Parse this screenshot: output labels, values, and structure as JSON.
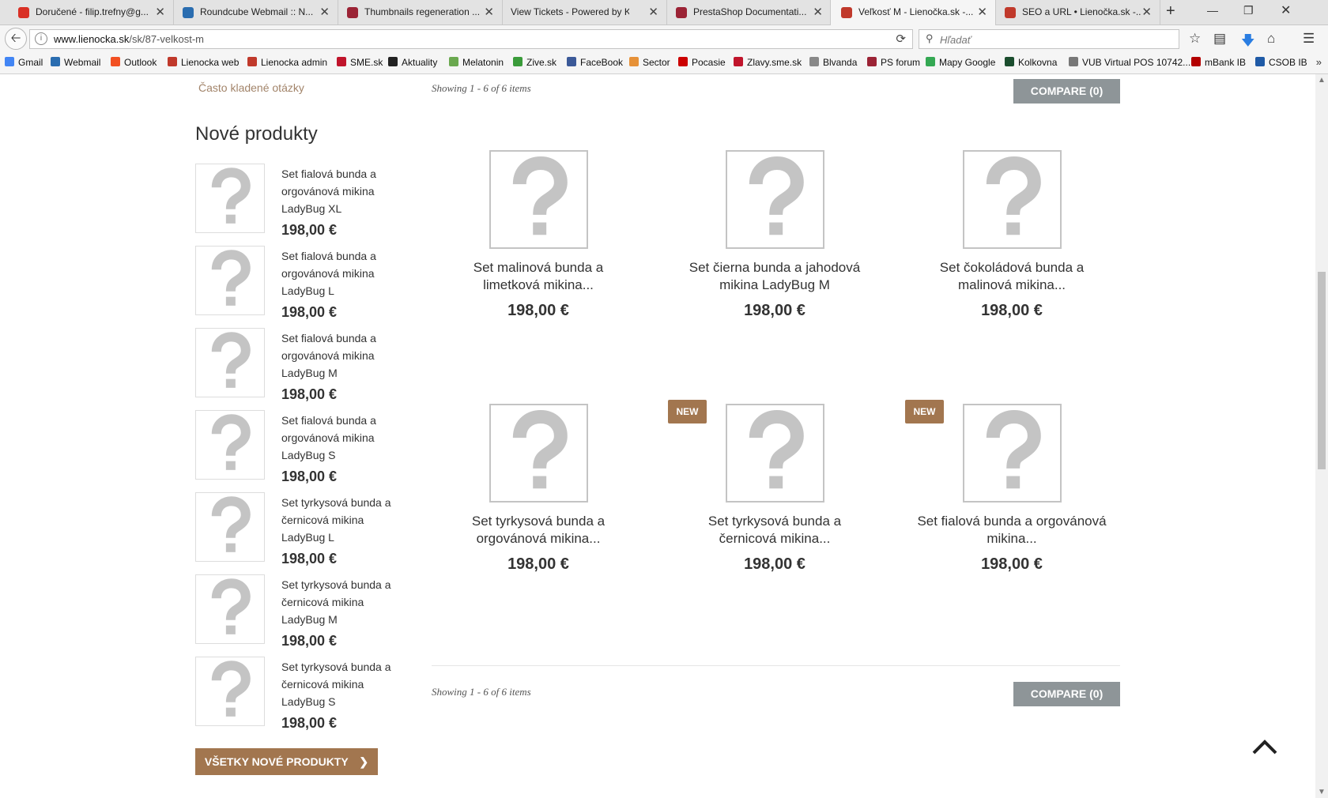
{
  "browser": {
    "tabs": [
      {
        "title": "Doručené - filip.trefny@g...",
        "icon": "gmail-icon",
        "color": "#d93025",
        "active": false
      },
      {
        "title": "Roundcube Webmail :: N...",
        "icon": "roundcube-icon",
        "color": "#2a6db0",
        "active": false
      },
      {
        "title": "Thumbnails regeneration ...",
        "icon": "prestashop-icon",
        "color": "#9b2335",
        "active": false
      },
      {
        "title": "View Tickets - Powered by Ka...",
        "icon": "",
        "color": "",
        "active": false
      },
      {
        "title": "PrestaShop Documentati...",
        "icon": "prestashop-icon",
        "color": "#9b2335",
        "active": false
      },
      {
        "title": "Veľkosť M - Lienočka.sk -...",
        "icon": "lienocka-icon",
        "color": "#c0392b",
        "active": true
      },
      {
        "title": "SEO a URL • Lienočka.sk -...",
        "icon": "lienocka-icon",
        "color": "#c0392b",
        "active": false
      }
    ],
    "url_host": "www.lienocka.sk",
    "url_path": "/sk/87-velkost-m",
    "search_placeholder": "Hľadať",
    "bookmarks": [
      {
        "label": "Gmail",
        "color": "#4285f4"
      },
      {
        "label": "Webmail",
        "color": "#2a6db0"
      },
      {
        "label": "Outlook",
        "color": "#f25022"
      },
      {
        "label": "Lienocka web",
        "color": "#c0392b"
      },
      {
        "label": "Lienocka admin",
        "color": "#c0392b"
      },
      {
        "label": "SME.sk",
        "color": "#c0142b"
      },
      {
        "label": "Aktuality",
        "color": "#222222"
      },
      {
        "label": "Melatonin",
        "color": "#6aa84f"
      },
      {
        "label": "Zive.sk",
        "color": "#3a9b3a"
      },
      {
        "label": "FaceBook",
        "color": "#3b5998"
      },
      {
        "label": "Sector",
        "color": "#e69138"
      },
      {
        "label": "Pocasie",
        "color": "#cc0000"
      },
      {
        "label": "Zlavy.sme.sk",
        "color": "#c0142b"
      },
      {
        "label": "Blvanda",
        "color": "#888888"
      },
      {
        "label": "PS forum",
        "color": "#9b2335"
      },
      {
        "label": "Mapy Google",
        "color": "#34a853"
      },
      {
        "label": "Kolkovna",
        "color": "#1b4d2e"
      },
      {
        "label": "VUB Virtual POS 10742...",
        "color": "#777777"
      },
      {
        "label": "mBank IB",
        "color": "#b30000"
      },
      {
        "label": "CSOB IB",
        "color": "#1f5aa6"
      }
    ]
  },
  "page": {
    "faq_link": "Často kladené otázky",
    "sidebar_title": "Nové produkty",
    "new_products": [
      {
        "name": "Set fialová bunda a orgovánová mikina LadyBug XL",
        "price": "198,00 €"
      },
      {
        "name": "Set fialová bunda a orgovánová mikina LadyBug L",
        "price": "198,00 €"
      },
      {
        "name": "Set fialová bunda a orgovánová mikina LadyBug M",
        "price": "198,00 €"
      },
      {
        "name": "Set fialová bunda a orgovánová mikina LadyBug S",
        "price": "198,00 €"
      },
      {
        "name": "Set tyrkysová bunda a černicová mikina LadyBug L",
        "price": "198,00 €"
      },
      {
        "name": "Set tyrkysová bunda a černicová mikina LadyBug M",
        "price": "198,00 €"
      },
      {
        "name": "Set tyrkysová bunda a černicová mikina LadyBug S",
        "price": "198,00 €"
      }
    ],
    "all_new_button": "VŠETKY NOVÉ PRODUKTY",
    "showing_text": "Showing 1 - 6 of 6 items",
    "compare_label": "COMPARE (0)",
    "products": [
      {
        "name": "Set malinová bunda a limetková mikina...",
        "price": "198,00 €",
        "badge": ""
      },
      {
        "name": "Set čierna bunda a jahodová mikina LadyBug M",
        "price": "198,00 €",
        "badge": ""
      },
      {
        "name": "Set čokoládová bunda a malinová mikina...",
        "price": "198,00 €",
        "badge": ""
      },
      {
        "name": "Set tyrkysová bunda a orgovánová mikina...",
        "price": "198,00 €",
        "badge": ""
      },
      {
        "name": "Set tyrkysová bunda a černicová mikina...",
        "price": "198,00 €",
        "badge": "NEW"
      },
      {
        "name": "Set fialová bunda a orgovánová mikina...",
        "price": "198,00 €",
        "badge": "NEW"
      }
    ],
    "colors": {
      "accent": "#a2764f",
      "compare_bg": "#8e9598",
      "placeholder_gray": "#c4c4c4"
    }
  }
}
